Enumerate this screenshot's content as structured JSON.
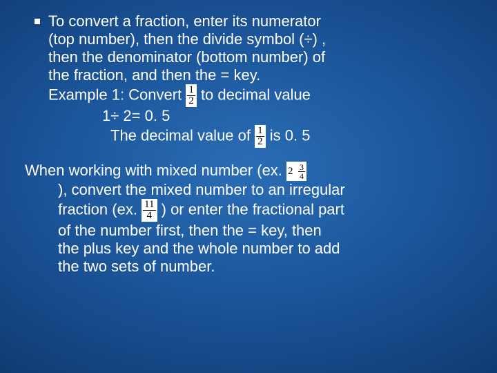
{
  "bullet": {
    "line1": "To convert a fraction, enter its numerator",
    "line2": "(top number), then the divide symbol (÷) ,",
    "line3": "then the denominator (bottom number) of",
    "line4": "the fraction, and then the = key."
  },
  "example": {
    "line1a": "Example 1: Convert ",
    "line1b": " to decimal value",
    "frac1": {
      "num": "1",
      "den": "2"
    },
    "line2": "1÷ 2=   0. 5",
    "line3a": "The decimal value of ",
    "line3b": " is 0. 5",
    "frac2": {
      "num": "1",
      "den": "2"
    }
  },
  "mixed": {
    "line1a": "When working with mixed number (ex. ",
    "mixed1": {
      "whole": "2",
      "num": "3",
      "den": "4"
    },
    "line2": "), convert the mixed number to an irregular",
    "line3a": "fraction (ex. ",
    "frac3": {
      "num": "11",
      "den": "4"
    },
    "line3b": ") or enter the fractional part",
    "line4": "of the number   first, then the = key, then",
    "line5": "the plus key and the whole number to add",
    "line6": "the two sets of number."
  }
}
